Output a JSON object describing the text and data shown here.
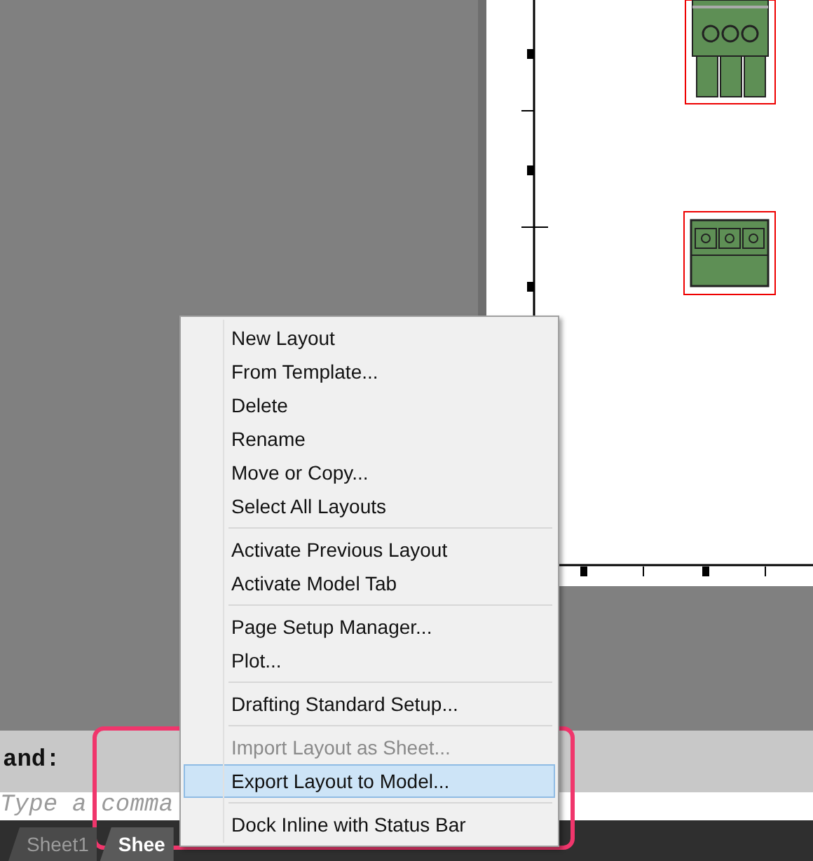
{
  "context_menu": {
    "groups": [
      [
        {
          "label": "New Layout",
          "disabled": false,
          "selected": false
        },
        {
          "label": "From Template...",
          "disabled": false,
          "selected": false
        },
        {
          "label": "Delete",
          "disabled": false,
          "selected": false
        },
        {
          "label": "Rename",
          "disabled": false,
          "selected": false
        },
        {
          "label": "Move or Copy...",
          "disabled": false,
          "selected": false
        },
        {
          "label": "Select All Layouts",
          "disabled": false,
          "selected": false
        }
      ],
      [
        {
          "label": "Activate Previous Layout",
          "disabled": false,
          "selected": false
        },
        {
          "label": "Activate Model Tab",
          "disabled": false,
          "selected": false
        }
      ],
      [
        {
          "label": "Page Setup Manager...",
          "disabled": false,
          "selected": false
        },
        {
          "label": "Plot...",
          "disabled": false,
          "selected": false
        }
      ],
      [
        {
          "label": "Drafting Standard Setup...",
          "disabled": false,
          "selected": false
        }
      ],
      [
        {
          "label": "Import Layout as Sheet...",
          "disabled": true,
          "selected": false
        },
        {
          "label": "Export Layout to Model...",
          "disabled": false,
          "selected": true
        }
      ],
      [
        {
          "label": "Dock Inline with Status Bar",
          "disabled": false,
          "selected": false
        }
      ]
    ]
  },
  "command_line": {
    "prompt": "and:",
    "placeholder": "Type a comma"
  },
  "layout_tabs": [
    {
      "label": "Sheet1",
      "selected": false
    },
    {
      "label": "Shee",
      "selected": true
    }
  ]
}
